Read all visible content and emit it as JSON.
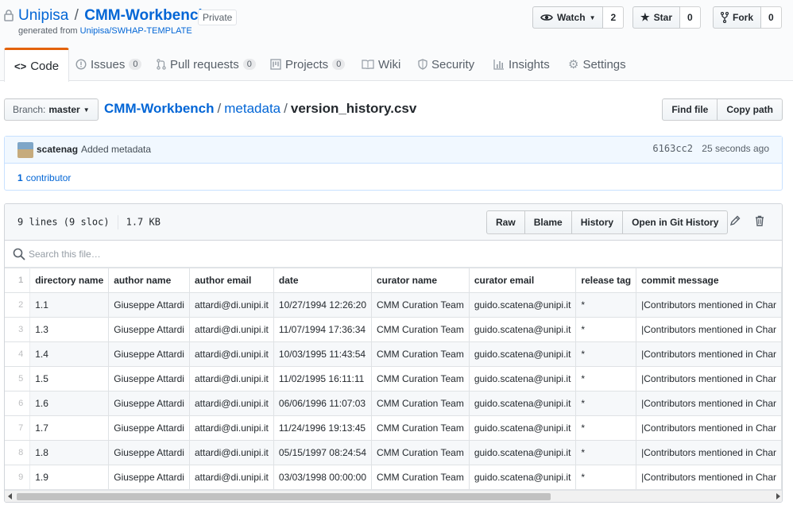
{
  "repo": {
    "owner": "Unipisa",
    "name": "CMM-Workbench",
    "visibility": "Private",
    "generated_prefix": "generated from",
    "template": "Unipisa/SWHAP-TEMPLATE"
  },
  "actions": {
    "watch_label": "Watch",
    "watch_count": "2",
    "star_label": "Star",
    "star_count": "0",
    "fork_label": "Fork",
    "fork_count": "0"
  },
  "tabs": [
    {
      "label": "Code"
    },
    {
      "label": "Issues",
      "count": "0"
    },
    {
      "label": "Pull requests",
      "count": "0"
    },
    {
      "label": "Projects",
      "count": "0"
    },
    {
      "label": "Wiki"
    },
    {
      "label": "Security"
    },
    {
      "label": "Insights"
    },
    {
      "label": "Settings"
    }
  ],
  "branch": {
    "prefix": "Branch:",
    "name": "master"
  },
  "breadcrumb": {
    "root": "CMM-Workbench",
    "dir": "metadata",
    "file": "version_history.csv",
    "sep": "/"
  },
  "file_nav": {
    "find_file": "Find file",
    "copy_path": "Copy path"
  },
  "commit": {
    "author": "scatenag",
    "message": "Added metadata",
    "sha": "6163cc2",
    "age": "25 seconds ago",
    "contributors_count": "1",
    "contributors_label": "contributor"
  },
  "file": {
    "lines": "9 lines (9 sloc)",
    "size": "1.7 KB",
    "buttons": {
      "raw": "Raw",
      "blame": "Blame",
      "history": "History",
      "git_history": "Open in Git History"
    }
  },
  "search": {
    "placeholder": "Search this file…"
  },
  "table": {
    "headers": [
      "directory name",
      "author name",
      "author email",
      "date",
      "curator name",
      "curator email",
      "release tag",
      "commit message"
    ],
    "rows": [
      [
        "1.1",
        "Giuseppe Attardi",
        "attardi@di.unipi.it",
        "10/27/1994 12:26:20",
        "CMM Curation Team",
        "guido.scatena@unipi.it",
        "*",
        "|Contributors mentioned in Char"
      ],
      [
        "1.3",
        "Giuseppe Attardi",
        "attardi@di.unipi.it",
        "11/07/1994 17:36:34",
        "CMM Curation Team",
        "guido.scatena@unipi.it",
        "*",
        "|Contributors mentioned in Char"
      ],
      [
        "1.4",
        "Giuseppe Attardi",
        "attardi@di.unipi.it",
        "10/03/1995 11:43:54",
        "CMM Curation Team",
        "guido.scatena@unipi.it",
        "*",
        "|Contributors mentioned in Char"
      ],
      [
        "1.5",
        "Giuseppe Attardi",
        "attardi@di.unipi.it",
        "11/02/1995 16:11:11",
        "CMM Curation Team",
        "guido.scatena@unipi.it",
        "*",
        "|Contributors mentioned in Char"
      ],
      [
        "1.6",
        "Giuseppe Attardi",
        "attardi@di.unipi.it",
        "06/06/1996 11:07:03",
        "CMM Curation Team",
        "guido.scatena@unipi.it",
        "*",
        "|Contributors mentioned in Char"
      ],
      [
        "1.7",
        "Giuseppe Attardi",
        "attardi@di.unipi.it",
        "11/24/1996 19:13:45",
        "CMM Curation Team",
        "guido.scatena@unipi.it",
        "*",
        "|Contributors mentioned in Char"
      ],
      [
        "1.8",
        "Giuseppe Attardi",
        "attardi@di.unipi.it",
        "05/15/1997 08:24:54",
        "CMM Curation Team",
        "guido.scatena@unipi.it",
        "*",
        "|Contributors mentioned in Char"
      ],
      [
        "1.9",
        "Giuseppe Attardi",
        "attardi@di.unipi.it",
        "03/03/1998 00:00:00",
        "CMM Curation Team",
        "guido.scatena@unipi.it",
        "*",
        "|Contributors mentioned in Char"
      ]
    ]
  },
  "icons": [
    "lock-icon",
    "eye-icon",
    "star-icon",
    "fork-icon",
    "code-icon",
    "issue-icon",
    "pull-request-icon",
    "project-icon",
    "wiki-icon",
    "shield-icon",
    "graph-icon",
    "gear-icon",
    "pencil-icon",
    "trash-icon",
    "search-icon"
  ]
}
